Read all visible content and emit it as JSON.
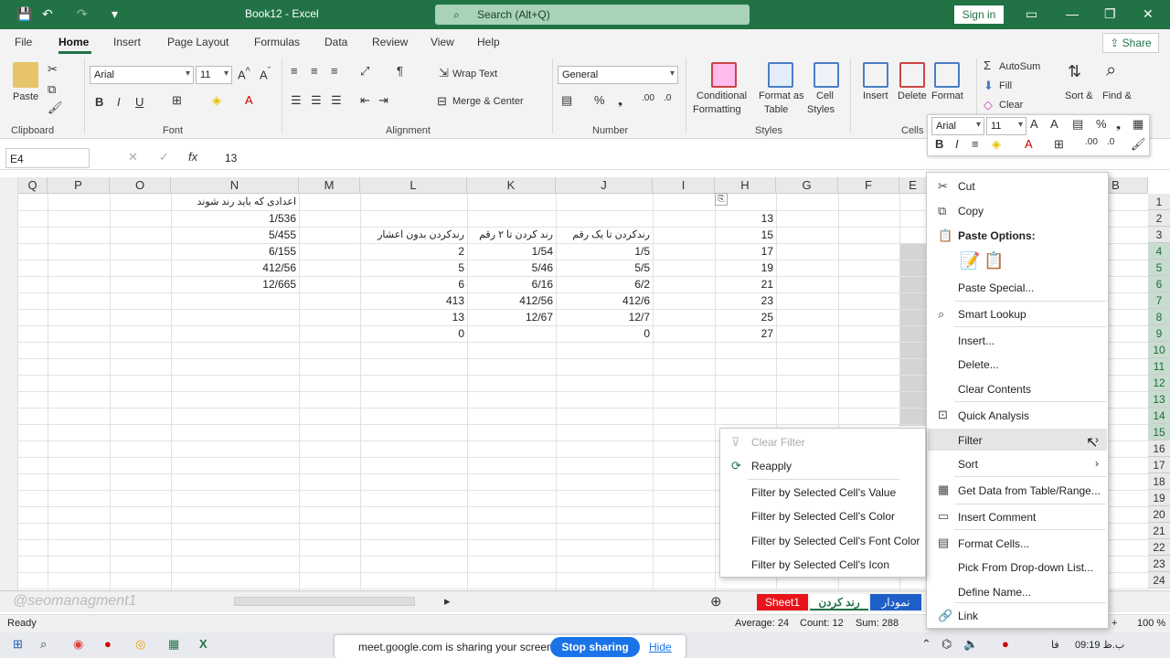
{
  "title_bar": {
    "doc_title": "Book12  -  Excel",
    "search_placeholder": "Search (Alt+Q)",
    "sign_in": "Sign in"
  },
  "menu": {
    "tabs": [
      "File",
      "Home",
      "Insert",
      "Page Layout",
      "Formulas",
      "Data",
      "Review",
      "View",
      "Help"
    ],
    "active": "Home",
    "share": "Share"
  },
  "ribbon": {
    "paste": "Paste",
    "clipboard": "Clipboard",
    "font_name": "Arial",
    "font_size": "11",
    "font": "Font",
    "wrap_text": "Wrap Text",
    "merge_center": "Merge & Center",
    "alignment": "Alignment",
    "number_format": "General",
    "number": "Number",
    "conditional": "Conditional",
    "formatting": "Formatting",
    "format_as": "Format as",
    "table": "Table",
    "cell": "Cell",
    "styles_btn": "Styles",
    "styles": "Styles",
    "insert": "Insert",
    "delete": "Delete",
    "format": "Format",
    "cells": "Cells",
    "autosum": "AutoSum",
    "fill": "Fill",
    "clear": "Clear",
    "sort_filter": "Sort &",
    "filter": "Filter",
    "find_select": "Find &",
    "select": "Select"
  },
  "formula_bar": {
    "name_box": "E4",
    "value": "13"
  },
  "columns": [
    "Q",
    "P",
    "O",
    "N",
    "M",
    "L",
    "K",
    "J",
    "I",
    "H",
    "G",
    "F",
    "E",
    "B"
  ],
  "rows": [
    "1",
    "2",
    "3",
    "4",
    "5",
    "6",
    "7",
    "8",
    "9",
    "10",
    "11",
    "12",
    "13",
    "14",
    "15",
    "16",
    "17",
    "18",
    "19",
    "20",
    "21",
    "22",
    "23",
    "24"
  ],
  "cells": {
    "N1": "اعدادی که باید رند شوند",
    "N2": "1/536",
    "N3": "5/455",
    "N4": "6/155",
    "N5": "412/56",
    "N6": "12/665",
    "L3": "رندکردن بدون اعشار",
    "K3": "رند کردن تا ۲ رقم",
    "J3": "رندکردن تا یک رقم",
    "L4": "2",
    "K4": "1/54",
    "J4": "1/5",
    "L5": "5",
    "K5": "5/46",
    "J5": "5/5",
    "L6": "6",
    "K6": "6/16",
    "J6": "6/2",
    "L7": "413",
    "K7": "412/56",
    "J7": "412/6",
    "L8": "13",
    "K8": "12/67",
    "J8": "12/7",
    "L9": "0",
    "J9": "0",
    "H2": "13",
    "H3": "15",
    "H4": "17",
    "H5": "19",
    "H6": "21",
    "H7": "23",
    "H8": "25",
    "H9": "27"
  },
  "context_menu": {
    "items": [
      "Cut",
      "Copy",
      "Paste Options:",
      "Paste Special...",
      "Smart Lookup",
      "Insert...",
      "Delete...",
      "Clear Contents",
      "Quick Analysis",
      "Filter",
      "Sort",
      "Get Data from Table/Range...",
      "Insert Comment",
      "Format Cells...",
      "Pick From Drop-down List...",
      "Define Name...",
      "Link"
    ]
  },
  "mini_toolbar": {
    "font": "Arial",
    "size": "11"
  },
  "filter_submenu": {
    "items": [
      "Clear Filter",
      "Reapply",
      "Filter by Selected Cell's Value",
      "Filter by Selected Cell's Color",
      "Filter by Selected Cell's Font Color",
      "Filter by Selected Cell's Icon"
    ]
  },
  "sheets": {
    "tabs": [
      "Sheet1",
      "رند کردن",
      "نمودار"
    ],
    "watermark": "@seomanagment1"
  },
  "status": {
    "ready": "Ready",
    "average": "Average: 24",
    "count": "Count: 12",
    "sum": "Sum: 288",
    "zoom": "100 %"
  },
  "taskbar": {
    "banner": "meet.google.com is sharing your screen.",
    "stop": "Stop sharing",
    "hide": "Hide",
    "clock": "09:19 ب.ظ",
    "lang": "فا"
  },
  "colors": {
    "excel_green": "#217346",
    "sheet1_tab": "#e8141c",
    "nemodar_tab": "#1f5fc8"
  }
}
